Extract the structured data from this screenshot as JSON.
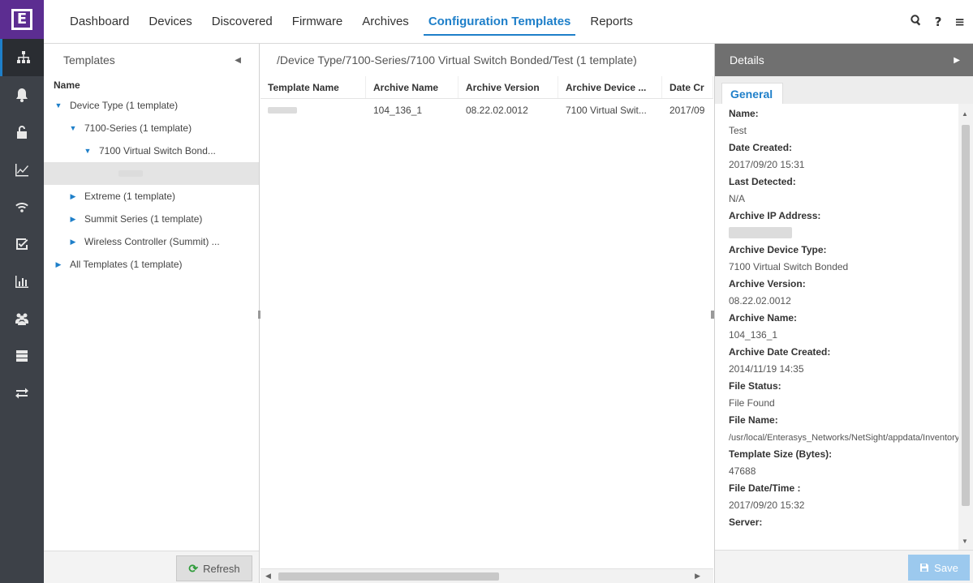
{
  "rail": {
    "items": [
      {
        "name": "sitemap-icon",
        "active": true
      },
      {
        "name": "bell-icon"
      },
      {
        "name": "lock-icon"
      },
      {
        "name": "analytics-icon"
      },
      {
        "name": "wifi-icon"
      },
      {
        "name": "checklist-icon"
      },
      {
        "name": "bar-chart-icon"
      },
      {
        "name": "users-icon"
      },
      {
        "name": "server-icon"
      },
      {
        "name": "transfer-icon"
      }
    ]
  },
  "nav": {
    "tabs": [
      "Dashboard",
      "Devices",
      "Discovered",
      "Firmware",
      "Archives",
      "Configuration Templates",
      "Reports"
    ],
    "active_tab": "Configuration Templates"
  },
  "templates_panel": {
    "title": "Templates",
    "column_header": "Name",
    "tree": [
      {
        "label": "Device Type (1 template)",
        "expanded": true
      },
      {
        "label": "7100-Series (1 template)",
        "expanded": true
      },
      {
        "label": "7100 Virtual Switch Bond...",
        "expanded": true
      },
      {
        "label": "",
        "redacted": true,
        "selected": true
      },
      {
        "label": "Extreme (1 template)",
        "expanded": false
      },
      {
        "label": "Summit Series (1 template)",
        "expanded": false
      },
      {
        "label": "Wireless Controller (Summit) ...",
        "expanded": false
      },
      {
        "label": "All Templates (1 template)",
        "expanded": false
      }
    ],
    "refresh_label": "Refresh"
  },
  "center": {
    "path": "/Device Type/7100-Series/7100 Virtual Switch Bonded/Test (1 template)",
    "columns": [
      "Template Name",
      "Archive Name",
      "Archive Version",
      "Archive Device ...",
      "Date Cr"
    ],
    "rows": [
      {
        "template_name": "",
        "archive_name": "104_136_1",
        "archive_version": "08.22.02.0012",
        "archive_device": "7100 Virtual Swit...",
        "date": "2017/09"
      }
    ]
  },
  "details": {
    "title": "Details",
    "tab": "General",
    "fields": [
      {
        "label": "Name:",
        "value": "Test"
      },
      {
        "label": "Date Created:",
        "value": "2017/09/20 15:31"
      },
      {
        "label": "Last Detected:",
        "value": "N/A"
      },
      {
        "label": "Archive IP Address:",
        "value": "",
        "redacted": true
      },
      {
        "label": "Archive Device Type:",
        "value": "7100 Virtual Switch Bonded"
      },
      {
        "label": "Archive Version:",
        "value": "08.22.02.0012"
      },
      {
        "label": "Archive Name:",
        "value": "104_136_1"
      },
      {
        "label": "Archive Date Created:",
        "value": "2014/11/19 14:35"
      },
      {
        "label": "File Status:",
        "value": "File Found"
      },
      {
        "label": "File Name:",
        "value": "/usr/local/Enterasys_Networks/NetSight/appdata/InventoryMgr/config_templates/Test.tpt",
        "wrap": true
      },
      {
        "label": "Template Size (Bytes):",
        "value": "47688"
      },
      {
        "label": "File Date/Time :",
        "value": "2017/09/20 15:32"
      },
      {
        "label": "Server:",
        "value": ""
      }
    ],
    "save_label": "Save"
  },
  "colors": {
    "accent": "#1e7fc9",
    "rail": "#3d4148",
    "logo": "#5c2d91",
    "details_header": "#707070"
  }
}
